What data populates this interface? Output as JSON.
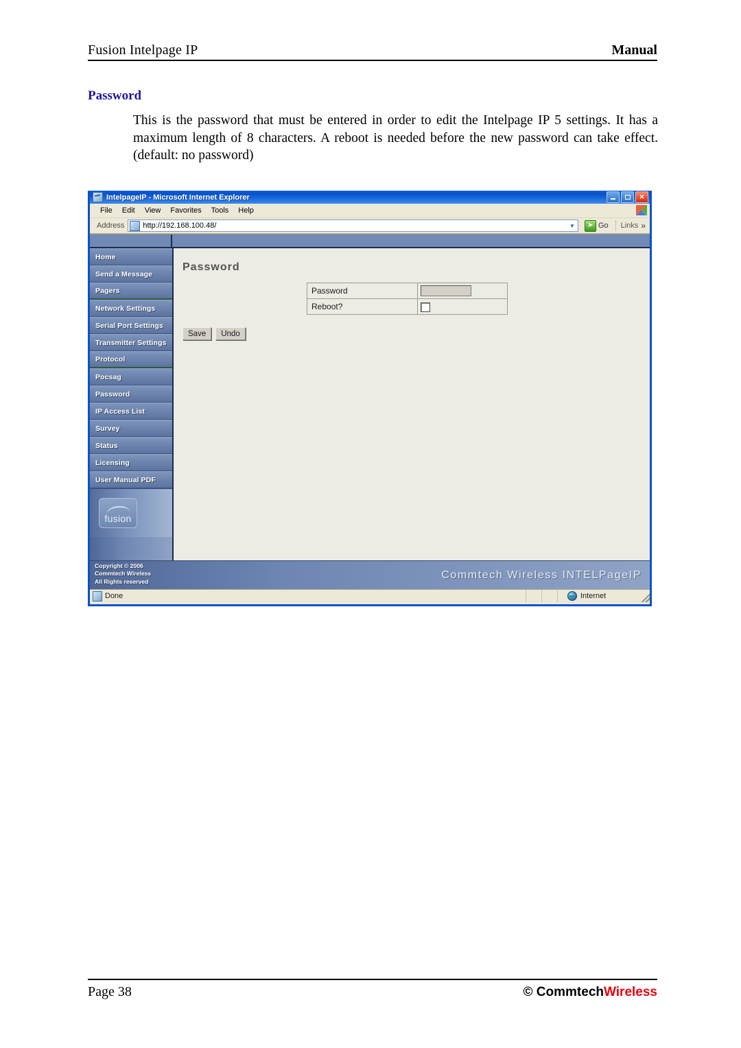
{
  "document": {
    "header_left": "Fusion Intelpage IP",
    "header_right": "Manual",
    "section_title": "Password",
    "body_paragraph": "This is the password that must be entered in order to edit the Intelpage IP 5 settings. It has a maximum length of 8 characters. A reboot is needed before the new password can take effect. (default: no password)",
    "footer_left": "Page 38",
    "footer_right_symbol": "© Commtech",
    "footer_right_accent": "Wireless",
    "footer_accent_color": "#e8000d",
    "section_title_color": "#1b189e"
  },
  "browser": {
    "title": "IntelpageIP - Microsoft Internet Explorer",
    "window_buttons": {
      "minimize": "_",
      "maximize": "□",
      "close": "✕"
    },
    "menu": [
      "File",
      "Edit",
      "View",
      "Favorites",
      "Tools",
      "Help"
    ],
    "address": {
      "label": "Address",
      "url": "http://192.168.100.48/",
      "dropdown_icon": "▼",
      "go_label": "Go",
      "go_icon": "➤",
      "links_label": "Links",
      "links_chevron": "»"
    },
    "status": {
      "text": "Done",
      "zone": "Internet"
    }
  },
  "webpage": {
    "heading": "Password",
    "nav": [
      {
        "label": "Home",
        "separator_after": false
      },
      {
        "label": "Send a Message",
        "separator_after": false
      },
      {
        "label": "Pagers",
        "separator_after": true
      },
      {
        "label": "Network Settings",
        "separator_after": false
      },
      {
        "label": "Serial Port Settings",
        "separator_after": false
      },
      {
        "label": "Transmitter Settings",
        "separator_after": false
      },
      {
        "label": "Protocol",
        "separator_after": true
      },
      {
        "label": "Pocsag",
        "separator_after": false
      },
      {
        "label": "Password",
        "separator_after": false
      },
      {
        "label": "IP Access List",
        "separator_after": false
      },
      {
        "label": "Survey",
        "separator_after": false
      },
      {
        "label": "Status",
        "separator_after": false
      },
      {
        "label": "Licensing",
        "separator_after": false
      },
      {
        "label": "User Manual PDF",
        "separator_after": false
      }
    ],
    "logo_text": "fusion",
    "copyright_line1": "Copyright © 2006",
    "copyright_line2": "Commtech Wireless",
    "copyright_line3": "All Rights reserved",
    "brand_footer": "Commtech Wireless INTELPageIP",
    "form": {
      "rows": [
        {
          "label": "Password",
          "control": "textbox",
          "value": ""
        },
        {
          "label": "Reboot?",
          "control": "checkbox",
          "checked": false
        }
      ],
      "save_label": "Save",
      "undo_label": "Undo"
    }
  }
}
